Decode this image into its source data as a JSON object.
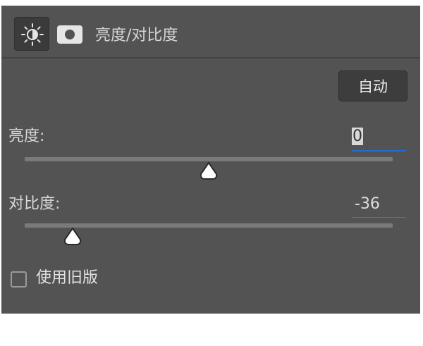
{
  "header": {
    "tab_adjustments_icon": "brightness-icon",
    "tab_mask_icon": "mask-icon",
    "title": "亮度/对比度"
  },
  "auto_button": {
    "label": "自动"
  },
  "brightness": {
    "label": "亮度:",
    "value": "0",
    "level": 0.5
  },
  "contrast": {
    "label": "对比度:",
    "value": "-36",
    "level": 0.13
  },
  "legacy": {
    "label": "使用旧版",
    "checked": false
  },
  "colors": {
    "panel_bg": "#535353",
    "focus_underline": "#1f6fd1"
  }
}
